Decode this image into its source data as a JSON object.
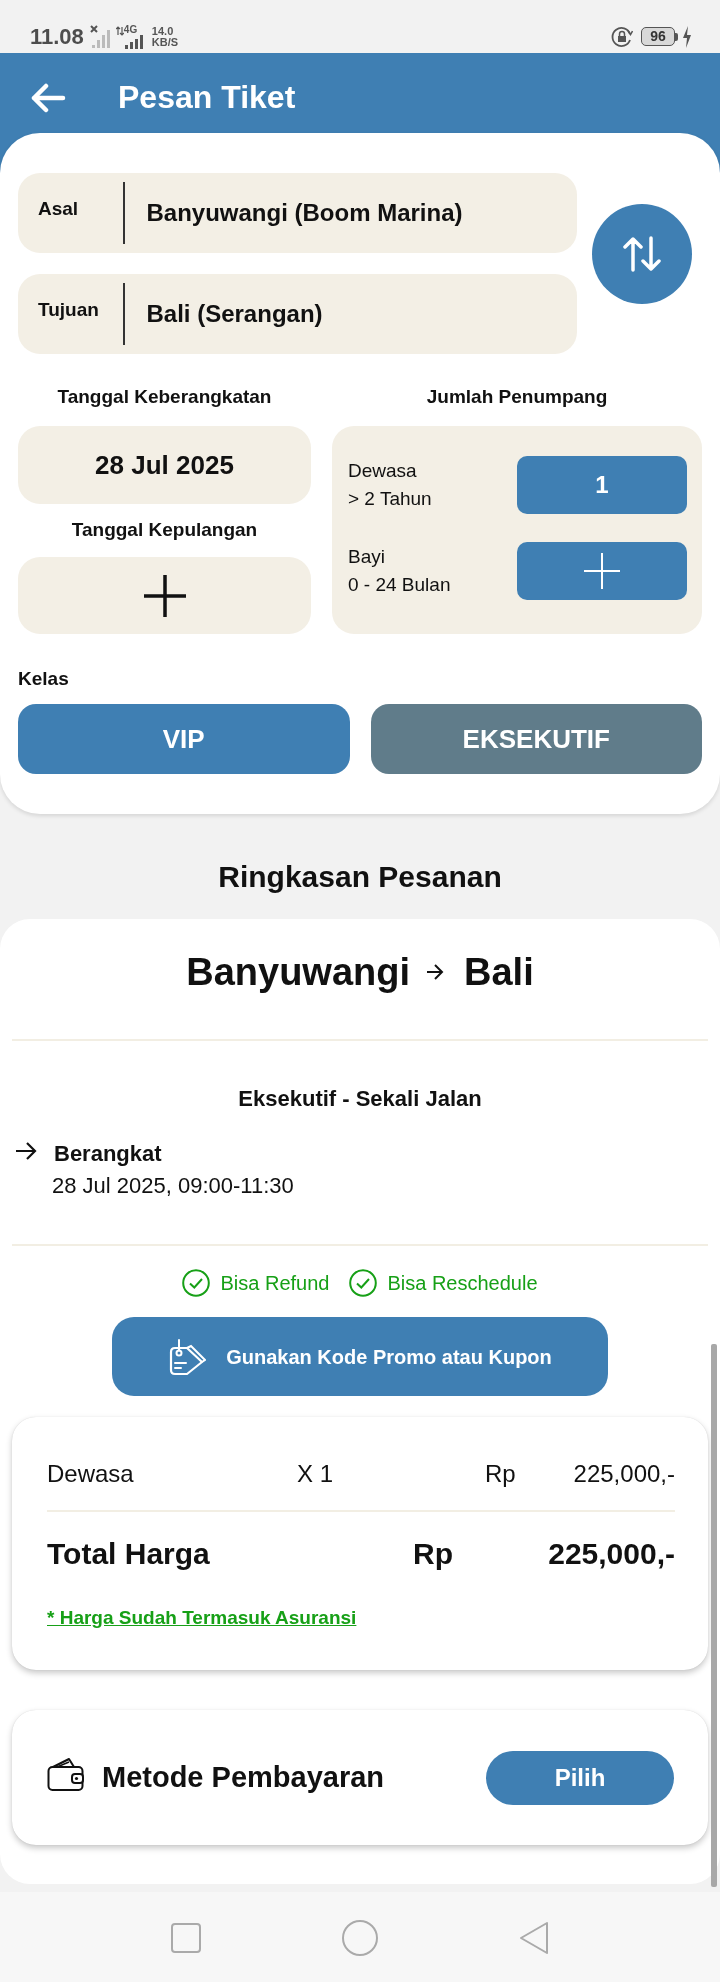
{
  "status_bar": {
    "time": "11.08",
    "network_type": "4G",
    "speed": "14.0",
    "speed_unit": "KB/S",
    "battery": "96"
  },
  "app_bar": {
    "title": "Pesan Tiket"
  },
  "route_fields": [
    {
      "label": "Asal",
      "value": "Banyuwangi (Boom Marina)"
    },
    {
      "label": "Tujuan",
      "value": "Bali (Serangan)"
    }
  ],
  "departure_date": {
    "label": "Tanggal Keberangkatan",
    "value": "28 Jul 2025"
  },
  "return_date": {
    "label": "Tanggal Kepulangan"
  },
  "passengers": {
    "label": "Jumlah Penumpang",
    "groups": [
      {
        "name": "Dewasa",
        "range": "> 2 Tahun",
        "kind": "count",
        "count": "1"
      },
      {
        "name": "Bayi",
        "range": "0 - 24 Bulan",
        "kind": "add"
      }
    ]
  },
  "class_selector": {
    "label": "Kelas",
    "options": [
      {
        "label": "VIP",
        "selected": false
      },
      {
        "label": "EKSEKUTIF",
        "selected": true
      }
    ]
  },
  "summary": {
    "title": "Ringkasan Pesanan",
    "origin": "Banyuwangi",
    "destination": "Bali",
    "trip_type": "Eksekutif - Sekali Jalan",
    "departure": {
      "label": "Berangkat",
      "datetime": "28 Jul 2025, 09:00-11:30"
    },
    "policies": [
      "Bisa Refund",
      "Bisa Reschedule"
    ],
    "promo_button": "Gunakan Kode Promo atau Kupon",
    "price": {
      "lines": [
        {
          "label": "Dewasa",
          "quantity": "X 1",
          "currency": "Rp",
          "amount": "225,000,-"
        }
      ],
      "total": {
        "label": "Total Harga",
        "currency": "Rp",
        "amount": "225,000,-"
      },
      "note": "* Harga Sudah Termasuk Asuransi"
    },
    "payment": {
      "label": "Metode Pembayaran",
      "button": "Pilih"
    }
  }
}
